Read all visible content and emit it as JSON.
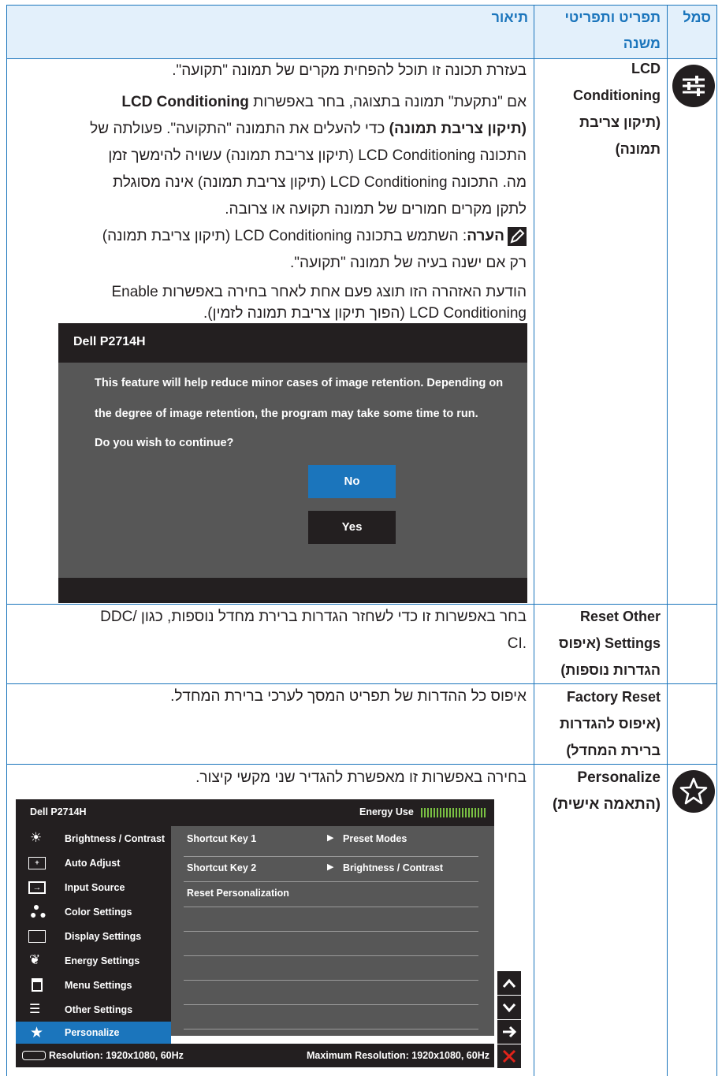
{
  "header": {
    "col_icon": "סמל",
    "col_menu_1": "תפריט ותפריטי",
    "col_menu_2": "משנה",
    "col_desc": "תיאור"
  },
  "rows": {
    "lcd": {
      "sub_1": "LCD",
      "sub_2": "Conditioning",
      "sub_3": "(תיקון צריבת",
      "sub_4": "תמונה)",
      "line_1": "בעזרת תכונה זו תוכל להפחית מקרים של תמונה \"תקועה\".",
      "line_2": "אם \"נתקעת\" תמונה בתצוגה, בחר באפשרות LCD Conditioning",
      "line_3": "(תיקון צריבת תמונה) כדי להעלים את התמונה \"התקועה\". פעולתה של",
      "line_4": "התכונה LCD Conditioning (תיקון צריבת תמונה) עשויה להימשך זמן",
      "line_5": "מה. התכונה LCD Conditioning (תיקון צריבת תמונה) אינה מסוגלת",
      "line_6": "לתקן מקרים חמורים של תמונה תקועה או צרובה.",
      "note_label": "הערה",
      "note_1": ": השתמש בתכונה LCD Conditioning (תיקון צריבת תמונה)",
      "note_2": "רק אם ישנה בעיה של תמונה \"תקועה\".",
      "warn_1": "הודעת האזהרה הזו תוצג פעם אחת לאחר בחירה באפשרות Enable",
      "warn_2": "LCD Conditioning (הפוך תיקון צריבת תמונה לזמין)."
    },
    "reset_other": {
      "sub_1": "Reset Other",
      "sub_2": "Settings (איפוס",
      "sub_3": "הגדרות נוספות)",
      "line_1": "בחר באפשרות זו כדי לשחזר הגדרות ברירת מחדל נוספות, כגון /DDC",
      "line_2": ".CI"
    },
    "factory": {
      "sub_1": "Factory Reset",
      "sub_2": "(איפוס להגדרות",
      "sub_3": "ברירת המחדל)",
      "line_1": "איפוס כל ההדרות של תפריט המסך לערכי ברירת המחדל."
    },
    "personalize": {
      "sub_1": "Personalize",
      "sub_2": "(התאמה אישית)",
      "line_1": "בחירה באפשרות זו מאפשרת להגדיר שני מקשי קיצור."
    }
  },
  "dialog": {
    "title": "Dell P2714H",
    "msg_1": "This feature will help reduce minor cases of image retention. Depending on",
    "msg_2": "the degree of image retention, the program may take some time to run.",
    "msg_3": "Do you wish to continue?",
    "no": "No",
    "yes": "Yes",
    "colors": {
      "no_bg": "#1b75bc",
      "yes_bg": "#231f20"
    }
  },
  "osd": {
    "title": "Dell P2714H",
    "energy_label": "Energy Use",
    "menu": [
      {
        "label": "Brightness / Contrast",
        "icon": "sun-icon"
      },
      {
        "label": "Auto Adjust",
        "icon": "auto-adjust-icon"
      },
      {
        "label": "Input Source",
        "icon": "input-source-icon"
      },
      {
        "label": "Color Settings",
        "icon": "color-dots-icon"
      },
      {
        "label": "Display Settings",
        "icon": "display-icon"
      },
      {
        "label": "Energy Settings",
        "icon": "leaf-icon"
      },
      {
        "label": "Menu Settings",
        "icon": "menu-icon"
      },
      {
        "label": "Other Settings",
        "icon": "sliders-icon"
      },
      {
        "label": "Personalize",
        "icon": "star-icon"
      }
    ],
    "rows": [
      {
        "label": "Shortcut Key 1",
        "value": "Preset Modes"
      },
      {
        "label": "Shortcut Key 2",
        "value": "Brightness / Contrast"
      },
      {
        "label": "Reset Personalization",
        "value": ""
      }
    ],
    "resolution": "Resolution: 1920x1080, 60Hz",
    "max_resolution": "Maximum Resolution: 1920x1080, 60Hz",
    "selected_item": "Personalize",
    "colors": {
      "accent": "#1b75bc",
      "close": "#e2231a"
    }
  }
}
